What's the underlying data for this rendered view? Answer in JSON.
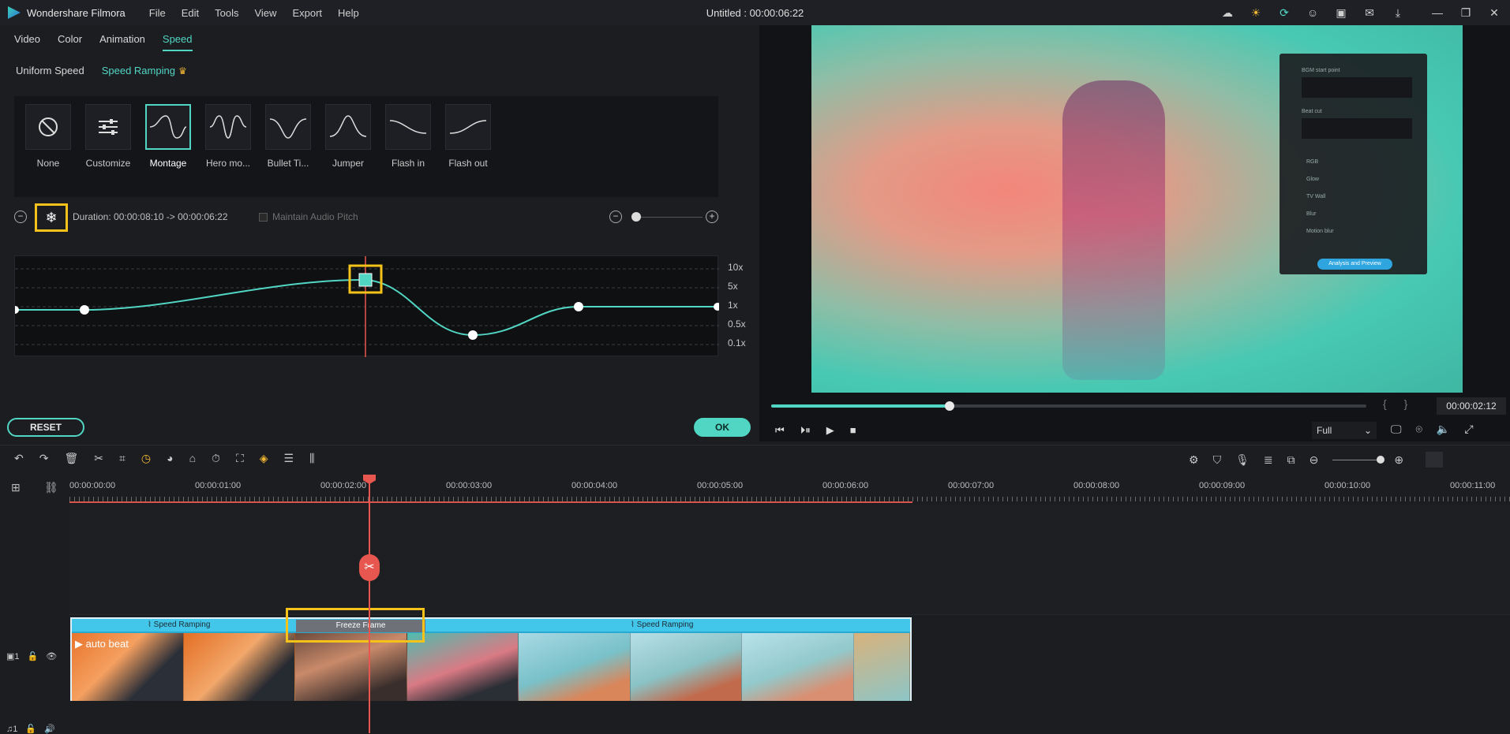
{
  "app": {
    "name": "Wondershare Filmora",
    "title": "Untitled : 00:00:06:22",
    "menu": [
      "File",
      "Edit",
      "Tools",
      "View",
      "Export",
      "Help"
    ],
    "title_icons": [
      "cloud-icon",
      "bulb-icon",
      "sync-icon",
      "account-icon",
      "save-icon",
      "mail-icon",
      "download-icon",
      "minimize-icon",
      "restore-icon",
      "close-icon"
    ]
  },
  "panel": {
    "tabs": [
      "Video",
      "Color",
      "Animation",
      "Speed"
    ],
    "active_tab": "Speed",
    "subtabs": [
      "Uniform Speed",
      "Speed Ramping"
    ],
    "active_subtab": "Speed Ramping",
    "presets": [
      "None",
      "Customize",
      "Montage",
      "Hero mo...",
      "Bullet Ti...",
      "Jumper",
      "Flash in",
      "Flash out"
    ],
    "selected_preset": "Montage",
    "duration_label": "Duration:",
    "duration_value": "00:00:08:10 -> 00:00:06:22",
    "maintain_audio": "Maintain Audio Pitch",
    "speed_labels": [
      "10x",
      "5x",
      "1x",
      "0.5x",
      "0.1x"
    ],
    "reset": "RESET",
    "ok": "OK"
  },
  "preview": {
    "timecode": "00:00:02:12",
    "progress_fraction": 0.3,
    "quality": "Full",
    "overlay": {
      "bgm_label": "BGM start point",
      "beat_label": "Beat cut",
      "rows": [
        "RGB",
        "Glow",
        "TV Wall",
        "Blur",
        "Motion blur"
      ],
      "button": "Analysis and Preview"
    }
  },
  "toolbar": {
    "left_icons": [
      "undo-icon",
      "redo-icon",
      "delete-icon",
      "cut-icon",
      "crop-icon",
      "speed-icon",
      "color-icon",
      "stabilize-icon",
      "timer-icon",
      "fit-icon",
      "keyframe-icon",
      "adjust-icon",
      "audio-icon"
    ],
    "right_icons": [
      "render-icon",
      "marker-icon",
      "mic-icon",
      "voiceover-icon",
      "pip-icon",
      "zoom-out-icon",
      "zoom-in-icon"
    ]
  },
  "timeline": {
    "ruler": [
      "00:00:00:00",
      "00:00:01:00",
      "00:00:02:00",
      "00:00:03:00",
      "00:00:04:00",
      "00:00:05:00",
      "00:00:06:00",
      "00:00:07:00",
      "00:00:08:00",
      "00:00:09:00",
      "00:00:10:00",
      "00:00:11:00"
    ],
    "band_left": "Speed Ramping",
    "band_freeze": "Freeze Frame",
    "band_right": "Speed Ramping",
    "clip_label": "auto beat",
    "video_track": "1",
    "audio_track": "1"
  }
}
